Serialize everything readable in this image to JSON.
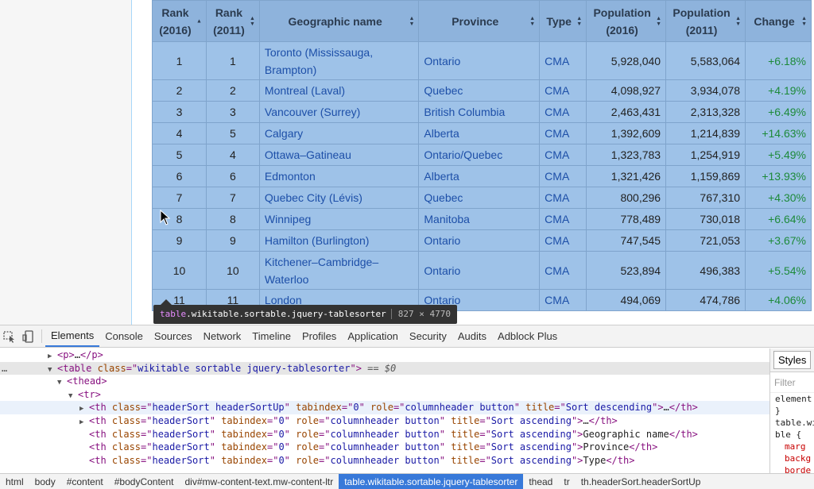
{
  "table": {
    "headers": [
      "Rank\n(2016)",
      "Rank\n(2011)",
      "Geographic name",
      "Province",
      "Type",
      "Population\n(2016)",
      "Population\n(2011)",
      "Change"
    ],
    "rows": [
      {
        "r16": "1",
        "r11": "1",
        "name": "Toronto (Mississauga, Brampton)",
        "prov": "Ontario",
        "type": "CMA",
        "p16": "5,928,040",
        "p11": "5,583,064",
        "chg": "+6.18%"
      },
      {
        "r16": "2",
        "r11": "2",
        "name": "Montreal (Laval)",
        "prov": "Quebec",
        "type": "CMA",
        "p16": "4,098,927",
        "p11": "3,934,078",
        "chg": "+4.19%"
      },
      {
        "r16": "3",
        "r11": "3",
        "name": "Vancouver (Surrey)",
        "prov": "British Columbia",
        "type": "CMA",
        "p16": "2,463,431",
        "p11": "2,313,328",
        "chg": "+6.49%"
      },
      {
        "r16": "4",
        "r11": "5",
        "name": "Calgary",
        "prov": "Alberta",
        "type": "CMA",
        "p16": "1,392,609",
        "p11": "1,214,839",
        "chg": "+14.63%"
      },
      {
        "r16": "5",
        "r11": "4",
        "name": "Ottawa–Gatineau",
        "prov": "Ontario/Quebec",
        "type": "CMA",
        "p16": "1,323,783",
        "p11": "1,254,919",
        "chg": "+5.49%"
      },
      {
        "r16": "6",
        "r11": "6",
        "name": "Edmonton",
        "prov": "Alberta",
        "type": "CMA",
        "p16": "1,321,426",
        "p11": "1,159,869",
        "chg": "+13.93%"
      },
      {
        "r16": "7",
        "r11": "7",
        "name": "Quebec City (Lévis)",
        "prov": "Quebec",
        "type": "CMA",
        "p16": "800,296",
        "p11": "767,310",
        "chg": "+4.30%"
      },
      {
        "r16": "8",
        "r11": "8",
        "name": "Winnipeg",
        "prov": "Manitoba",
        "type": "CMA",
        "p16": "778,489",
        "p11": "730,018",
        "chg": "+6.64%"
      },
      {
        "r16": "9",
        "r11": "9",
        "name": "Hamilton (Burlington)",
        "prov": "Ontario",
        "type": "CMA",
        "p16": "747,545",
        "p11": "721,053",
        "chg": "+3.67%"
      },
      {
        "r16": "10",
        "r11": "10",
        "name": "Kitchener–Cambridge–Waterloo",
        "prov": "Ontario",
        "type": "CMA",
        "p16": "523,894",
        "p11": "496,383",
        "chg": "+5.54%"
      },
      {
        "r16": "11",
        "r11": "11",
        "name": "London",
        "prov": "Ontario",
        "type": "CMA",
        "p16": "494,069",
        "p11": "474,786",
        "chg": "+4.06%"
      }
    ]
  },
  "tooltip": {
    "tag": "table",
    "classes": ".wikitable.sortable.jquery-tablesorter",
    "size": "827 × 4770"
  },
  "devtools": {
    "tabs": [
      "Elements",
      "Console",
      "Sources",
      "Network",
      "Timeline",
      "Profiles",
      "Application",
      "Security",
      "Audits",
      "Adblock Plus"
    ],
    "active_tab": "Elements",
    "styles_tab": "Styles",
    "filter_placeholder": "Filter",
    "styles_lines": [
      "element",
      "}",
      "table.wi",
      "ble {",
      "marg",
      "backg",
      "borde"
    ],
    "breadcrumbs": [
      "html",
      "body",
      "#content",
      "#bodyContent",
      "div#mw-content-text.mw-content-ltr",
      "table.wikitable.sortable.jquery-tablesorter",
      "thead",
      "tr",
      "th.headerSort.headerSortUp"
    ],
    "active_crumb": "table.wikitable.sortable.jquery-tablesorter",
    "dom": {
      "p_line": "…",
      "table_class": "wikitable sortable jquery-tablesorter",
      "eq0": "== $0",
      "th_lines": [
        {
          "cls": "headerSort headerSortUp",
          "tabindex": "0",
          "role": "columnheader button",
          "title": "Sort descending",
          "text": "…",
          "collapsed": true
        },
        {
          "cls": "headerSort",
          "tabindex": "0",
          "role": "columnheader button",
          "title": "Sort ascending",
          "text": "…",
          "collapsed": true
        },
        {
          "cls": "headerSort",
          "tabindex": "0",
          "role": "columnheader button",
          "title": "Sort ascending",
          "text": "Geographic name",
          "collapsed": false
        },
        {
          "cls": "headerSort",
          "tabindex": "0",
          "role": "columnheader button",
          "title": "Sort ascending",
          "text": "Province",
          "collapsed": false
        },
        {
          "cls": "headerSort",
          "tabindex": "0",
          "role": "columnheader button",
          "title": "Sort ascending",
          "text": "Type",
          "collapsed": false
        }
      ]
    }
  }
}
